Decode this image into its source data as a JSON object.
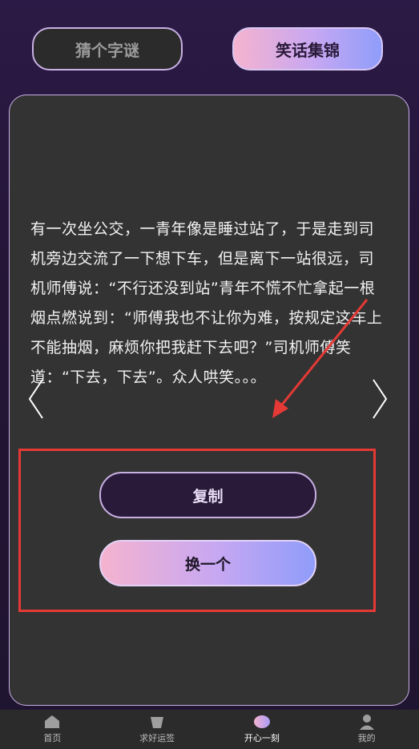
{
  "tabs": {
    "riddle_label": "猜个字谜",
    "jokes_label": "笑话集锦"
  },
  "joke": {
    "text": "有一次坐公交，一青年像是睡过站了，于是走到司机旁边交流了一下想下车，但是离下一站很远，司机师傅说：“不行还没到站”青年不慌不忙拿起一根烟点燃说到：“师傅我也不让你为难，按规定这车上不能抽烟，麻烦你把我赶下去吧？”司机师傅笑道：“下去，下去”。众人哄笑。。。"
  },
  "actions": {
    "copy_label": "复制",
    "next_label": "换一个"
  },
  "bottom_nav": {
    "items": [
      {
        "label": "首页",
        "icon": "home-icon"
      },
      {
        "label": "求好运签",
        "icon": "fortune-icon"
      },
      {
        "label": "开心一刻",
        "icon": "smile-icon"
      },
      {
        "label": "我的",
        "icon": "user-icon"
      }
    ],
    "active": "开心一刻"
  },
  "colors": {
    "accent_gradient_start": "#f5b3cf",
    "accent_gradient_end": "#8f9dfa",
    "card_border": "#c7b0e6",
    "annotation_red": "#e53935"
  }
}
